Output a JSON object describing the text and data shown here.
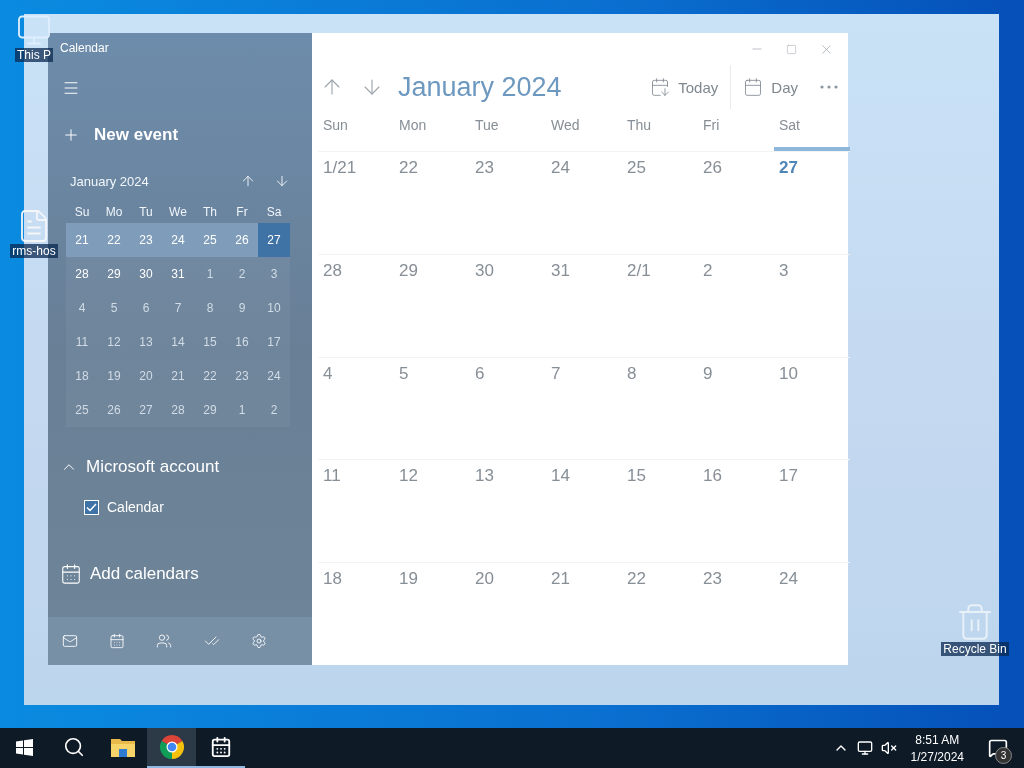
{
  "desktop": {
    "icons": [
      {
        "kind": "pc",
        "label": "This P"
      },
      {
        "kind": "file",
        "label": "rms-hos"
      },
      {
        "kind": "bin",
        "label": "Recycle Bin"
      }
    ]
  },
  "window": {
    "title": "Calendar"
  },
  "sidebar": {
    "new_event": "New event",
    "mini_calendar": {
      "month": "January 2024",
      "weekdays": [
        "Su",
        "Mo",
        "Tu",
        "We",
        "Th",
        "Fr",
        "Sa"
      ],
      "weeks": [
        {
          "current": true,
          "days": [
            {
              "day": "21",
              "in_month": true,
              "selected": false
            },
            {
              "day": "22",
              "in_month": true,
              "selected": false
            },
            {
              "day": "23",
              "in_month": true,
              "selected": false
            },
            {
              "day": "24",
              "in_month": true,
              "selected": false
            },
            {
              "day": "25",
              "in_month": true,
              "selected": false
            },
            {
              "day": "26",
              "in_month": true,
              "selected": false
            },
            {
              "day": "27",
              "in_month": true,
              "selected": true
            }
          ]
        },
        {
          "current": false,
          "days": [
            {
              "day": "28",
              "in_month": true,
              "selected": false
            },
            {
              "day": "29",
              "in_month": true,
              "selected": false
            },
            {
              "day": "30",
              "in_month": true,
              "selected": false
            },
            {
              "day": "31",
              "in_month": true,
              "selected": false
            },
            {
              "day": "1",
              "in_month": false,
              "selected": false
            },
            {
              "day": "2",
              "in_month": false,
              "selected": false
            },
            {
              "day": "3",
              "in_month": false,
              "selected": false
            }
          ]
        },
        {
          "current": false,
          "days": [
            {
              "day": "4",
              "in_month": false,
              "selected": false
            },
            {
              "day": "5",
              "in_month": false,
              "selected": false
            },
            {
              "day": "6",
              "in_month": false,
              "selected": false
            },
            {
              "day": "7",
              "in_month": false,
              "selected": false
            },
            {
              "day": "8",
              "in_month": false,
              "selected": false
            },
            {
              "day": "9",
              "in_month": false,
              "selected": false
            },
            {
              "day": "10",
              "in_month": false,
              "selected": false
            }
          ]
        },
        {
          "current": false,
          "days": [
            {
              "day": "11",
              "in_month": false,
              "selected": false
            },
            {
              "day": "12",
              "in_month": false,
              "selected": false
            },
            {
              "day": "13",
              "in_month": false,
              "selected": false
            },
            {
              "day": "14",
              "in_month": false,
              "selected": false
            },
            {
              "day": "15",
              "in_month": false,
              "selected": false
            },
            {
              "day": "16",
              "in_month": false,
              "selected": false
            },
            {
              "day": "17",
              "in_month": false,
              "selected": false
            }
          ]
        },
        {
          "current": false,
          "days": [
            {
              "day": "18",
              "in_month": false,
              "selected": false
            },
            {
              "day": "19",
              "in_month": false,
              "selected": false
            },
            {
              "day": "20",
              "in_month": false,
              "selected": false
            },
            {
              "day": "21",
              "in_month": false,
              "selected": false
            },
            {
              "day": "22",
              "in_month": false,
              "selected": false
            },
            {
              "day": "23",
              "in_month": false,
              "selected": false
            },
            {
              "day": "24",
              "in_month": false,
              "selected": false
            }
          ]
        },
        {
          "current": false,
          "days": [
            {
              "day": "25",
              "in_month": false,
              "selected": false
            },
            {
              "day": "26",
              "in_month": false,
              "selected": false
            },
            {
              "day": "27",
              "in_month": false,
              "selected": false
            },
            {
              "day": "28",
              "in_month": false,
              "selected": false
            },
            {
              "day": "29",
              "in_month": false,
              "selected": false
            },
            {
              "day": "1",
              "in_month": false,
              "selected": false
            },
            {
              "day": "2",
              "in_month": false,
              "selected": false
            }
          ]
        }
      ]
    },
    "account": {
      "name": "Microsoft account",
      "expanded": true,
      "calendars": [
        {
          "label": "Calendar",
          "checked": true
        }
      ]
    },
    "add_calendars": "Add calendars",
    "nav": [
      {
        "kind": "mail"
      },
      {
        "kind": "calendar"
      },
      {
        "kind": "people"
      },
      {
        "kind": "todo"
      },
      {
        "kind": "settings"
      }
    ]
  },
  "main": {
    "month": "January 2024",
    "toolbar": [
      {
        "kind": "today",
        "label": "Today"
      },
      {
        "kind": "day",
        "label": "Day"
      }
    ],
    "weekdays": [
      {
        "label": "Sun",
        "selected": false
      },
      {
        "label": "Mon",
        "selected": false
      },
      {
        "label": "Tue",
        "selected": false
      },
      {
        "label": "Wed",
        "selected": false
      },
      {
        "label": "Thu",
        "selected": false
      },
      {
        "label": "Fri",
        "selected": false
      },
      {
        "label": "Sat",
        "selected": true
      }
    ],
    "weeks": [
      [
        {
          "label": "1/21",
          "today": false
        },
        {
          "label": "22",
          "today": false
        },
        {
          "label": "23",
          "today": false
        },
        {
          "label": "24",
          "today": false
        },
        {
          "label": "25",
          "today": false
        },
        {
          "label": "26",
          "today": false
        },
        {
          "label": "27",
          "today": true
        }
      ],
      [
        {
          "label": "28",
          "today": false
        },
        {
          "label": "29",
          "today": false
        },
        {
          "label": "30",
          "today": false
        },
        {
          "label": "31",
          "today": false
        },
        {
          "label": "2/1",
          "today": false
        },
        {
          "label": "2",
          "today": false
        },
        {
          "label": "3",
          "today": false
        }
      ],
      [
        {
          "label": "4",
          "today": false
        },
        {
          "label": "5",
          "today": false
        },
        {
          "label": "6",
          "today": false
        },
        {
          "label": "7",
          "today": false
        },
        {
          "label": "8",
          "today": false
        },
        {
          "label": "9",
          "today": false
        },
        {
          "label": "10",
          "today": false
        }
      ],
      [
        {
          "label": "11",
          "today": false
        },
        {
          "label": "12",
          "today": false
        },
        {
          "label": "13",
          "today": false
        },
        {
          "label": "14",
          "today": false
        },
        {
          "label": "15",
          "today": false
        },
        {
          "label": "16",
          "today": false
        },
        {
          "label": "17",
          "today": false
        }
      ],
      [
        {
          "label": "18",
          "today": false
        },
        {
          "label": "19",
          "today": false
        },
        {
          "label": "20",
          "today": false
        },
        {
          "label": "21",
          "today": false
        },
        {
          "label": "22",
          "today": false
        },
        {
          "label": "23",
          "today": false
        },
        {
          "label": "24",
          "today": false
        }
      ]
    ]
  },
  "taskbar": {
    "apps": [
      {
        "kind": "start",
        "open": false,
        "active": false
      },
      {
        "kind": "search",
        "open": false,
        "active": false
      },
      {
        "kind": "explorer",
        "open": false,
        "active": false
      },
      {
        "kind": "chrome",
        "open": true,
        "active": true
      },
      {
        "kind": "calendar",
        "open": true,
        "active": false
      }
    ],
    "tray": {
      "time": "8:51 AM",
      "date": "1/27/2024",
      "notifications": "3"
    }
  }
}
